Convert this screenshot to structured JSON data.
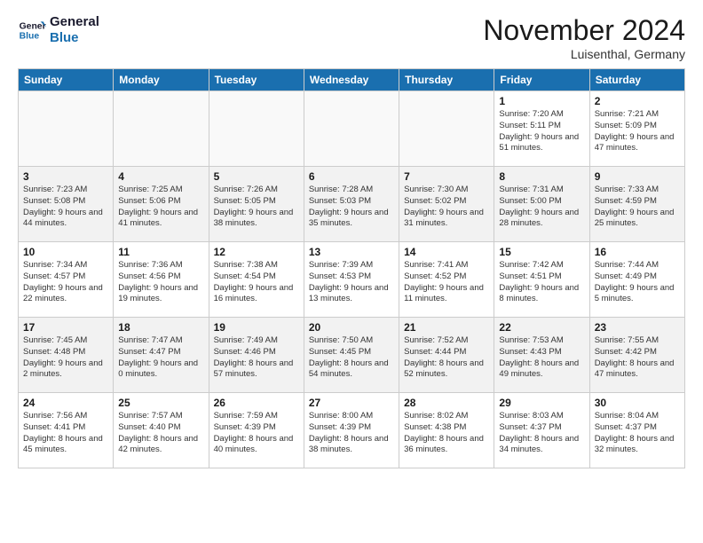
{
  "logo": {
    "line1": "General",
    "line2": "Blue"
  },
  "title": "November 2024",
  "location": "Luisenthal, Germany",
  "weekdays": [
    "Sunday",
    "Monday",
    "Tuesday",
    "Wednesday",
    "Thursday",
    "Friday",
    "Saturday"
  ],
  "weeks": [
    {
      "shade": false,
      "days": [
        {
          "num": "",
          "empty": true,
          "info": ""
        },
        {
          "num": "",
          "empty": true,
          "info": ""
        },
        {
          "num": "",
          "empty": true,
          "info": ""
        },
        {
          "num": "",
          "empty": true,
          "info": ""
        },
        {
          "num": "",
          "empty": true,
          "info": ""
        },
        {
          "num": "1",
          "empty": false,
          "info": "Sunrise: 7:20 AM\nSunset: 5:11 PM\nDaylight: 9 hours and 51 minutes."
        },
        {
          "num": "2",
          "empty": false,
          "info": "Sunrise: 7:21 AM\nSunset: 5:09 PM\nDaylight: 9 hours and 47 minutes."
        }
      ]
    },
    {
      "shade": true,
      "days": [
        {
          "num": "3",
          "empty": false,
          "info": "Sunrise: 7:23 AM\nSunset: 5:08 PM\nDaylight: 9 hours and 44 minutes."
        },
        {
          "num": "4",
          "empty": false,
          "info": "Sunrise: 7:25 AM\nSunset: 5:06 PM\nDaylight: 9 hours and 41 minutes."
        },
        {
          "num": "5",
          "empty": false,
          "info": "Sunrise: 7:26 AM\nSunset: 5:05 PM\nDaylight: 9 hours and 38 minutes."
        },
        {
          "num": "6",
          "empty": false,
          "info": "Sunrise: 7:28 AM\nSunset: 5:03 PM\nDaylight: 9 hours and 35 minutes."
        },
        {
          "num": "7",
          "empty": false,
          "info": "Sunrise: 7:30 AM\nSunset: 5:02 PM\nDaylight: 9 hours and 31 minutes."
        },
        {
          "num": "8",
          "empty": false,
          "info": "Sunrise: 7:31 AM\nSunset: 5:00 PM\nDaylight: 9 hours and 28 minutes."
        },
        {
          "num": "9",
          "empty": false,
          "info": "Sunrise: 7:33 AM\nSunset: 4:59 PM\nDaylight: 9 hours and 25 minutes."
        }
      ]
    },
    {
      "shade": false,
      "days": [
        {
          "num": "10",
          "empty": false,
          "info": "Sunrise: 7:34 AM\nSunset: 4:57 PM\nDaylight: 9 hours and 22 minutes."
        },
        {
          "num": "11",
          "empty": false,
          "info": "Sunrise: 7:36 AM\nSunset: 4:56 PM\nDaylight: 9 hours and 19 minutes."
        },
        {
          "num": "12",
          "empty": false,
          "info": "Sunrise: 7:38 AM\nSunset: 4:54 PM\nDaylight: 9 hours and 16 minutes."
        },
        {
          "num": "13",
          "empty": false,
          "info": "Sunrise: 7:39 AM\nSunset: 4:53 PM\nDaylight: 9 hours and 13 minutes."
        },
        {
          "num": "14",
          "empty": false,
          "info": "Sunrise: 7:41 AM\nSunset: 4:52 PM\nDaylight: 9 hours and 11 minutes."
        },
        {
          "num": "15",
          "empty": false,
          "info": "Sunrise: 7:42 AM\nSunset: 4:51 PM\nDaylight: 9 hours and 8 minutes."
        },
        {
          "num": "16",
          "empty": false,
          "info": "Sunrise: 7:44 AM\nSunset: 4:49 PM\nDaylight: 9 hours and 5 minutes."
        }
      ]
    },
    {
      "shade": true,
      "days": [
        {
          "num": "17",
          "empty": false,
          "info": "Sunrise: 7:45 AM\nSunset: 4:48 PM\nDaylight: 9 hours and 2 minutes."
        },
        {
          "num": "18",
          "empty": false,
          "info": "Sunrise: 7:47 AM\nSunset: 4:47 PM\nDaylight: 9 hours and 0 minutes."
        },
        {
          "num": "19",
          "empty": false,
          "info": "Sunrise: 7:49 AM\nSunset: 4:46 PM\nDaylight: 8 hours and 57 minutes."
        },
        {
          "num": "20",
          "empty": false,
          "info": "Sunrise: 7:50 AM\nSunset: 4:45 PM\nDaylight: 8 hours and 54 minutes."
        },
        {
          "num": "21",
          "empty": false,
          "info": "Sunrise: 7:52 AM\nSunset: 4:44 PM\nDaylight: 8 hours and 52 minutes."
        },
        {
          "num": "22",
          "empty": false,
          "info": "Sunrise: 7:53 AM\nSunset: 4:43 PM\nDaylight: 8 hours and 49 minutes."
        },
        {
          "num": "23",
          "empty": false,
          "info": "Sunrise: 7:55 AM\nSunset: 4:42 PM\nDaylight: 8 hours and 47 minutes."
        }
      ]
    },
    {
      "shade": false,
      "days": [
        {
          "num": "24",
          "empty": false,
          "info": "Sunrise: 7:56 AM\nSunset: 4:41 PM\nDaylight: 8 hours and 45 minutes."
        },
        {
          "num": "25",
          "empty": false,
          "info": "Sunrise: 7:57 AM\nSunset: 4:40 PM\nDaylight: 8 hours and 42 minutes."
        },
        {
          "num": "26",
          "empty": false,
          "info": "Sunrise: 7:59 AM\nSunset: 4:39 PM\nDaylight: 8 hours and 40 minutes."
        },
        {
          "num": "27",
          "empty": false,
          "info": "Sunrise: 8:00 AM\nSunset: 4:39 PM\nDaylight: 8 hours and 38 minutes."
        },
        {
          "num": "28",
          "empty": false,
          "info": "Sunrise: 8:02 AM\nSunset: 4:38 PM\nDaylight: 8 hours and 36 minutes."
        },
        {
          "num": "29",
          "empty": false,
          "info": "Sunrise: 8:03 AM\nSunset: 4:37 PM\nDaylight: 8 hours and 34 minutes."
        },
        {
          "num": "30",
          "empty": false,
          "info": "Sunrise: 8:04 AM\nSunset: 4:37 PM\nDaylight: 8 hours and 32 minutes."
        }
      ]
    }
  ]
}
